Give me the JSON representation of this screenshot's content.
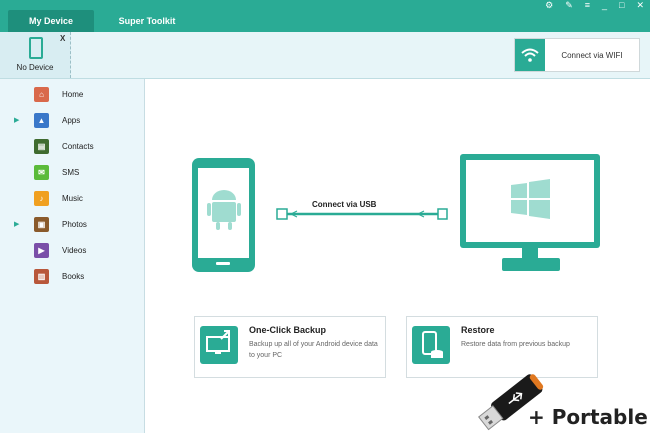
{
  "header": {
    "tabs": [
      {
        "label": "My Device"
      },
      {
        "label": "Super Toolkit"
      }
    ]
  },
  "device_bar": {
    "device_label": "No Device",
    "close_label": "X",
    "wifi_button_label": "Connect via WIFI"
  },
  "sidebar": {
    "items": [
      {
        "label": "Home",
        "icon": "home-icon",
        "expandable": false
      },
      {
        "label": "Apps",
        "icon": "apps-icon",
        "expandable": true
      },
      {
        "label": "Contacts",
        "icon": "contacts-icon",
        "expandable": false
      },
      {
        "label": "SMS",
        "icon": "sms-icon",
        "expandable": false
      },
      {
        "label": "Music",
        "icon": "music-icon",
        "expandable": false
      },
      {
        "label": "Photos",
        "icon": "photos-icon",
        "expandable": true
      },
      {
        "label": "Videos",
        "icon": "videos-icon",
        "expandable": false
      },
      {
        "label": "Books",
        "icon": "books-icon",
        "expandable": false
      }
    ]
  },
  "main": {
    "usb_label": "Connect via USB",
    "cards": [
      {
        "title": "One-Click Backup",
        "desc": "Backup up all of your Android device data to your PC"
      },
      {
        "title": "Restore",
        "desc": "Restore data from previous backup"
      }
    ]
  },
  "overlay": {
    "portable_label": "+ Portable"
  },
  "colors": {
    "accent": "#2aab95",
    "accent_dark": "#1e8f7c",
    "sidebar_bg": "#eaf6fa"
  }
}
